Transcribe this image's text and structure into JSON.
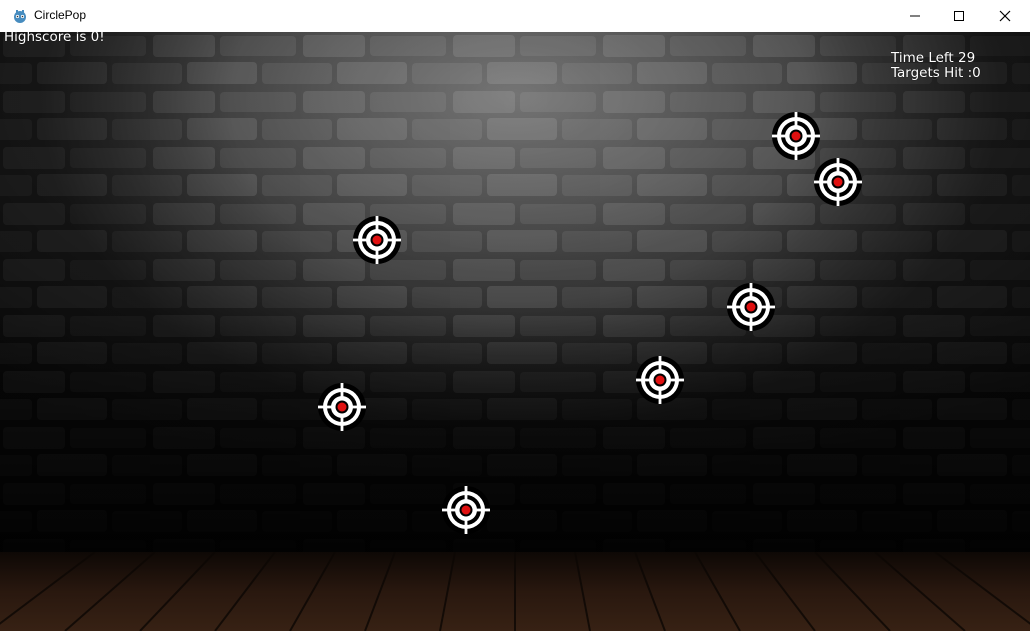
{
  "window": {
    "title": "CirclePop",
    "icon": "godot-icon",
    "controls": [
      "minimize-icon",
      "maximize-icon",
      "close-icon"
    ]
  },
  "hud": {
    "highscore": "Highscore is 0!",
    "time_left": "Time Left 29",
    "targets_hit": "Targets Hit :0"
  },
  "targets": [
    {
      "id": 1
    },
    {
      "id": 2
    },
    {
      "id": 3
    },
    {
      "id": 4
    },
    {
      "id": 5
    },
    {
      "id": 6
    },
    {
      "id": 7
    }
  ],
  "colors": {
    "target_center": "#e01010",
    "target_ring_dark": "#000000",
    "target_ring_light": "#ffffff"
  }
}
